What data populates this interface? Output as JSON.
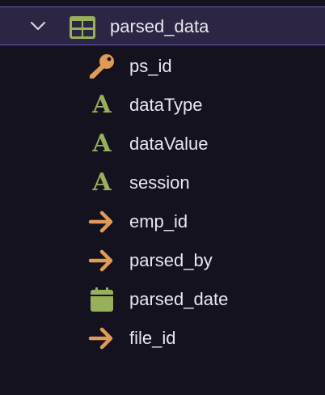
{
  "table": {
    "name": "parsed_data",
    "expanded": true,
    "icon": "table-grid-icon"
  },
  "colors": {
    "background": "#15121f",
    "selected_row": "#2c2644",
    "selected_border": "#6b5cc4",
    "key_orange": "#e39a55",
    "text_type_green": "#98b05c",
    "foreign_key_orange": "#e39a55",
    "date_green": "#98b05c"
  },
  "columns": [
    {
      "name": "ps_id",
      "icon": "key-icon"
    },
    {
      "name": "dataType",
      "icon": "text-type-icon",
      "glyph": "A"
    },
    {
      "name": "dataValue",
      "icon": "text-type-icon",
      "glyph": "A"
    },
    {
      "name": "session",
      "icon": "text-type-icon",
      "glyph": "A"
    },
    {
      "name": "emp_id",
      "icon": "foreign-key-arrow-icon"
    },
    {
      "name": "parsed_by",
      "icon": "foreign-key-arrow-icon"
    },
    {
      "name": "parsed_date",
      "icon": "calendar-icon"
    },
    {
      "name": "file_id",
      "icon": "foreign-key-arrow-icon"
    }
  ]
}
